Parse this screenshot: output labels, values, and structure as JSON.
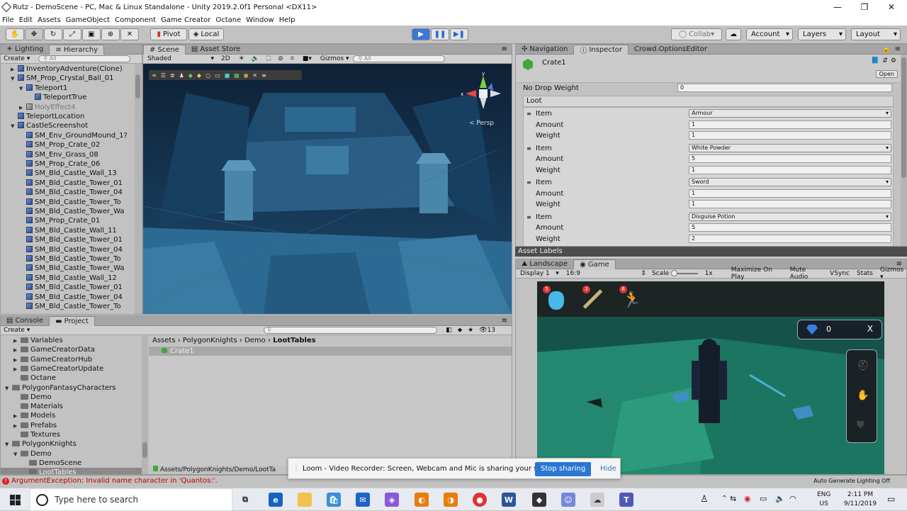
{
  "window": {
    "title": "Rutz - DemoScene - PC, Mac & Linux Standalone - Unity 2019.2.0f1 Personal <DX11>"
  },
  "menu": [
    "File",
    "Edit",
    "Assets",
    "GameObject",
    "Component",
    "Game Creator",
    "Octane",
    "Window",
    "Help"
  ],
  "toolbar": {
    "pivot": "Pivot",
    "local": "Local",
    "collab": "Collab",
    "account": "Account",
    "layers": "Layers",
    "layout": "Layout"
  },
  "hierarchy": {
    "tabs": [
      "Lighting",
      "Hierarchy"
    ],
    "create": "Create",
    "search_placeholder": "All",
    "items": [
      {
        "label": "InventoryAdventure(Clone)",
        "indent": 1,
        "arrow": "▶"
      },
      {
        "label": "SM_Prop_Crystal_Ball_01",
        "indent": 1,
        "arrow": "▼"
      },
      {
        "label": "Teleport1",
        "indent": 2,
        "arrow": "▼"
      },
      {
        "label": "TeleportTrue",
        "indent": 3,
        "arrow": ""
      },
      {
        "label": "HolyEffect4",
        "indent": 2,
        "arrow": "▶",
        "grey": true
      },
      {
        "label": "TeleportLocation",
        "indent": 1,
        "arrow": ""
      },
      {
        "label": "CastleScreenshot",
        "indent": 1,
        "arrow": "▼"
      },
      {
        "label": "SM_Env_GroundMound_1?",
        "indent": 2,
        "arrow": ""
      },
      {
        "label": "SM_Prop_Crate_02",
        "indent": 2,
        "arrow": ""
      },
      {
        "label": "SM_Env_Grass_08",
        "indent": 2,
        "arrow": ""
      },
      {
        "label": "SM_Prop_Crate_06",
        "indent": 2,
        "arrow": ""
      },
      {
        "label": "SM_Bld_Castle_Wall_13",
        "indent": 2,
        "arrow": ""
      },
      {
        "label": "SM_Bld_Castle_Tower_01",
        "indent": 2,
        "arrow": ""
      },
      {
        "label": "SM_Bld_Castle_Tower_04",
        "indent": 2,
        "arrow": ""
      },
      {
        "label": "SM_Bld_Castle_Tower_To",
        "indent": 2,
        "arrow": ""
      },
      {
        "label": "SM_Bld_Castle_Tower_Wa",
        "indent": 2,
        "arrow": ""
      },
      {
        "label": "SM_Prop_Crate_01",
        "indent": 2,
        "arrow": ""
      },
      {
        "label": "SM_Bld_Castle_Wall_11",
        "indent": 2,
        "arrow": ""
      },
      {
        "label": "SM_Bld_Castle_Tower_01",
        "indent": 2,
        "arrow": ""
      },
      {
        "label": "SM_Bld_Castle_Tower_04",
        "indent": 2,
        "arrow": ""
      },
      {
        "label": "SM_Bld_Castle_Tower_To",
        "indent": 2,
        "arrow": ""
      },
      {
        "label": "SM_Bld_Castle_Tower_Wa",
        "indent": 2,
        "arrow": ""
      },
      {
        "label": "SM_Bld_Castle_Wall_12",
        "indent": 2,
        "arrow": ""
      },
      {
        "label": "SM_Bld_Castle_Tower_01",
        "indent": 2,
        "arrow": ""
      },
      {
        "label": "SM_Bld_Castle_Tower_04",
        "indent": 2,
        "arrow": ""
      },
      {
        "label": "SM_Bld_Castle_Tower_To",
        "indent": 2,
        "arrow": ""
      }
    ]
  },
  "scene": {
    "tabs": [
      "Scene",
      "Asset Store"
    ],
    "shading": "Shaded",
    "mode_2d": "2D",
    "gizmos": "Gizmos",
    "search_placeholder": "All",
    "persp": "< Persp"
  },
  "inspector": {
    "tabs": [
      "Navigation",
      "Inspector",
      "Crowd.OptionsEditor"
    ],
    "object_name": "Crate1",
    "open": "Open",
    "no_drop_label": "No Drop Weight",
    "no_drop_value": "0",
    "loot_label": "Loot",
    "item_label": "Item",
    "amount_label": "Amount",
    "weight_label": "Weight",
    "loot": [
      {
        "item": "Armour",
        "amount": "1",
        "weight": "1"
      },
      {
        "item": "White Powder",
        "amount": "5",
        "weight": "1"
      },
      {
        "item": "Sword",
        "amount": "1",
        "weight": "1"
      },
      {
        "item": "Disguise Potion",
        "amount": "5",
        "weight": "2"
      }
    ],
    "asset_labels": "Asset Labels"
  },
  "game": {
    "tabs": [
      "Landscape",
      "Game"
    ],
    "display": "Display 1",
    "aspect": "16:9",
    "scale_label": "Scale",
    "scale_value": "1x",
    "options": [
      "Maximize On Play",
      "Mute Audio",
      "VSync",
      "Stats",
      "Gizmos"
    ],
    "badges": [
      "5",
      "3",
      "6"
    ],
    "gem_count": "0",
    "close": "X"
  },
  "project": {
    "tabs": [
      "Console",
      "Project"
    ],
    "create": "Create",
    "count": "13",
    "tree": [
      {
        "label": "Variables",
        "indent": 2,
        "arrow": "▶"
      },
      {
        "label": "GameCreatorData",
        "indent": 2,
        "arrow": "▶"
      },
      {
        "label": "GameCreatorHub",
        "indent": 2,
        "arrow": "▶"
      },
      {
        "label": "GameCreatorUpdate",
        "indent": 2,
        "arrow": "▶"
      },
      {
        "label": "Octane",
        "indent": 2,
        "arrow": ""
      },
      {
        "label": "PolygonFantasyCharacters",
        "indent": 1,
        "arrow": "▼"
      },
      {
        "label": "Demo",
        "indent": 2,
        "arrow": ""
      },
      {
        "label": "Materials",
        "indent": 2,
        "arrow": ""
      },
      {
        "label": "Models",
        "indent": 2,
        "arrow": "▶"
      },
      {
        "label": "Prefabs",
        "indent": 2,
        "arrow": "▶"
      },
      {
        "label": "Textures",
        "indent": 2,
        "arrow": ""
      },
      {
        "label": "PolygonKnights",
        "indent": 1,
        "arrow": "▼"
      },
      {
        "label": "Demo",
        "indent": 2,
        "arrow": "▼"
      },
      {
        "label": "DemoScene",
        "indent": 3,
        "arrow": ""
      },
      {
        "label": "LootTables",
        "indent": 3,
        "arrow": "",
        "selected": true
      }
    ],
    "breadcrumb": [
      "Assets",
      "PolygonKnights",
      "Demo",
      "LootTables"
    ],
    "file": "Crate1",
    "path": "Assets/PolygonKnights/Demo/LootTa"
  },
  "status": {
    "error": "ArgumentException: Invalid name character in 'Quantos:'.",
    "right": "Auto Generate Lighting Off"
  },
  "loom": {
    "text": "Loom - Video Recorder: Screen, Webcam and Mic is sharing your screen.",
    "stop": "Stop sharing",
    "hide": "Hide"
  },
  "taskbar": {
    "search_placeholder": "Type here to search",
    "lang": "ENG",
    "region": "US",
    "time": "2:11 PM",
    "date": "9/11/2019"
  }
}
